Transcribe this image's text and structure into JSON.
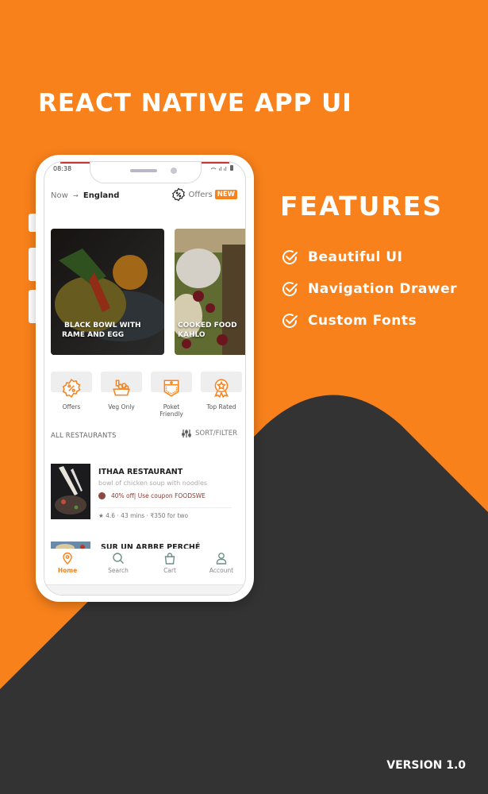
{
  "colors": {
    "accent": "#f8811b",
    "dark": "#333333",
    "white": "#ffffff"
  },
  "header": {
    "title": "REACT NATIVE APP UI"
  },
  "features": {
    "title": "FEATURES",
    "items": [
      {
        "icon": "check-circle-icon",
        "label": "Beautiful UI"
      },
      {
        "icon": "check-circle-icon",
        "label": "Navigation Drawer"
      },
      {
        "icon": "check-circle-icon",
        "label": "Custom Fonts"
      }
    ]
  },
  "version": "VERSION 1.0",
  "phone": {
    "status_bar": {
      "time": "08:38",
      "icons": "wifi, signal, battery"
    },
    "location": {
      "prefix": "Now",
      "arrow": "→",
      "city": "England"
    },
    "offers": {
      "label": "Offers",
      "badge": "NEW"
    },
    "cards": [
      {
        "title_line1": "BLACK BOWL WITH",
        "title_line2": "RAME AND EGG"
      },
      {
        "title_line1": "COOKED FOOD",
        "title_line2": "KAHLO"
      }
    ],
    "categories": [
      {
        "icon": "offer-badge-icon",
        "label": "Offers"
      },
      {
        "icon": "veg-basket-icon",
        "label": "Veg Only"
      },
      {
        "icon": "pocket-icon",
        "label": "Poket Friendly"
      },
      {
        "icon": "award-ribbon-icon",
        "label": "Top Rated"
      }
    ],
    "section_title": "ALL RESTAURANTS",
    "sort_label": "SORT/FILTER",
    "restaurants": [
      {
        "name": "ITHAA RESTAURANT",
        "description": "bowl of chicken soup with noodles",
        "offer": "40% off| Use coupon FOODSWE",
        "rating": "4.6",
        "time": "43 mins",
        "price": "₹350 for two",
        "meta": "★ 4.6 · 43 mins · ₹350 for two"
      },
      {
        "name": "SUR UN ARBRE PERCHÉ"
      }
    ],
    "bottom_nav": [
      {
        "icon": "location-pin-icon",
        "label": "Home",
        "active": true
      },
      {
        "icon": "search-icon",
        "label": "Search",
        "active": false
      },
      {
        "icon": "shopping-bag-icon",
        "label": "Cart",
        "active": false
      },
      {
        "icon": "user-icon",
        "label": "Account",
        "active": false
      }
    ]
  }
}
